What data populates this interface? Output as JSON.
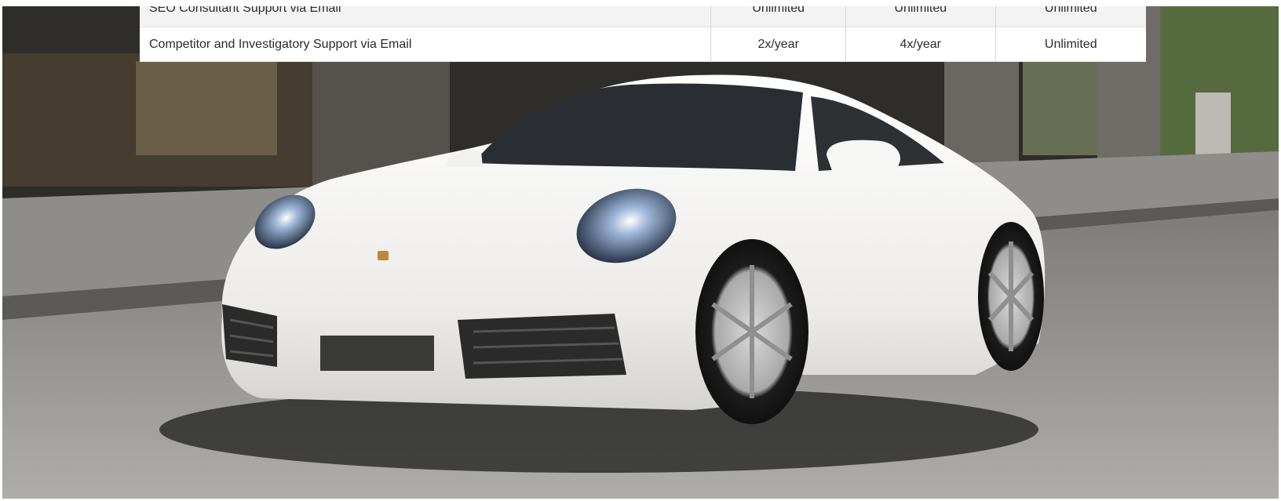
{
  "pricing_table": {
    "rows": [
      {
        "feature": "SEO Consultant Support via Email",
        "tier_1": "Unlimited",
        "tier_2": "Unlimited",
        "tier_3": "Unlimited"
      },
      {
        "feature": "Competitor and Investigatory Support via Email",
        "tier_1": "2x/year",
        "tier_2": "4x/year",
        "tier_3": "Unlimited"
      }
    ]
  },
  "hero": {
    "image": "white-sports-coupe-photo",
    "colors": {
      "car_body": "#f4f4f2",
      "road": "#9c9b98",
      "building": "#3a3834"
    }
  }
}
